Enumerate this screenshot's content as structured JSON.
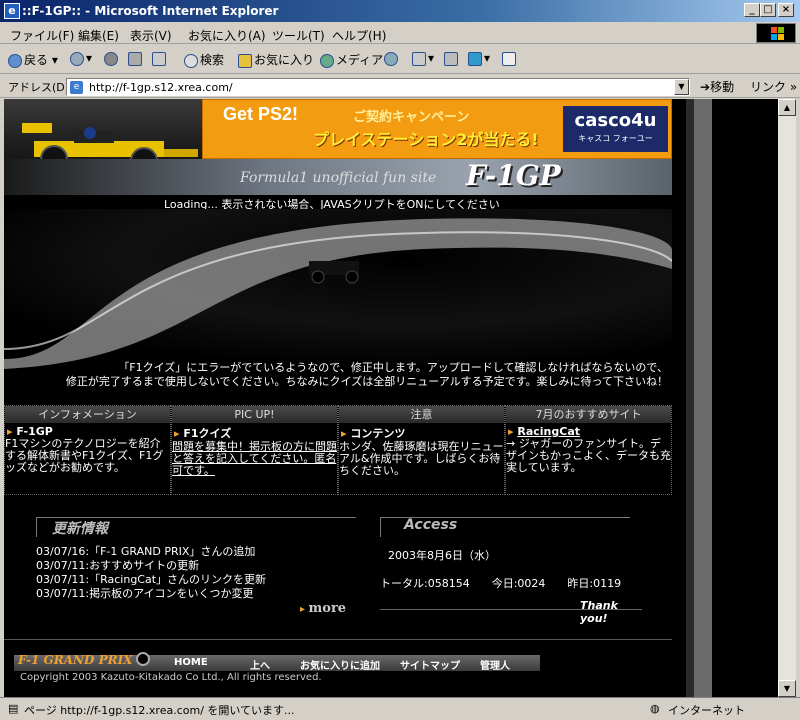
{
  "window": {
    "title": "::F-1GP:: - Microsoft Internet Explorer",
    "min_glyph": "_",
    "max_glyph": "□",
    "close_glyph": "×"
  },
  "menubar": {
    "items": [
      "ファイル(F)",
      "編集(E)",
      "表示(V)",
      "お気に入り(A)",
      "ツール(T)",
      "ヘルプ(H)"
    ]
  },
  "toolbar": {
    "back": "戻る",
    "search": "検索",
    "favorites": "お気に入り",
    "media": "メディア"
  },
  "address": {
    "label": "アドレス(D)",
    "url": "http://f-1gp.s12.xrea.com/",
    "go": "移動",
    "links": "リンク"
  },
  "page": {
    "banner": {
      "get_ps2": "Get PS2!",
      "campaign": "ご契約キャンペーン",
      "playstation": "プレイステーション2が当たる!",
      "casco": "casco4u",
      "casco_sub": "キャスコ フォーユー"
    },
    "tagline": "Formula1 unofficial fun site",
    "logo": "F-1GP",
    "loading": "Loading... 表示されない場合、JAVASクリプトをONにしてください",
    "notice_line1": "「F1クイズ」にエラーがでているようなので、修正中します。アップロードして確認しなければならないので、",
    "notice_line2": "修正が完了するまで使用しないでください。ちなみにクイズは全部リニューアルする予定です。楽しみに待って下さいね！",
    "columns": [
      {
        "head": "インフォメーション",
        "title": "F-1GP",
        "body": "F1マシンのテクノロジーを紹介する解体新書やF1クイズ、F1グッズなどがお勧めです。"
      },
      {
        "head": "PIC UP!",
        "title": "F1クイズ",
        "body": "問題を募集中！掲示板の方に問題と答えを記入してください。匿名可です。"
      },
      {
        "head": "注意",
        "title": "コンテンツ",
        "body": "ホンダ、佐藤琢磨は現在リニューアル&作成中です。しばらくお待ちください。"
      },
      {
        "head": "7月のおすすめサイト",
        "title": "RacingCat",
        "body": "→ ジャガーのファンサイト。デザインもかっこよく、データも充実しています。"
      }
    ],
    "updates": {
      "title": "更新情報",
      "lines": [
        "03/07/16:「F-1 GRAND PRIX」さんの追加",
        "03/07/11:おすすめサイトの更新",
        "03/07/11:「RacingCat」さんのリンクを更新",
        "03/07/11:掲示板のアイコンをいくつか変更"
      ],
      "more": "more"
    },
    "access": {
      "title": "Access",
      "date": "2003年8月6日（水）",
      "counts": "トータル:058154　　今日:0024　　昨日:0119",
      "thanks": "Thank you!"
    },
    "footer": {
      "logo": "F-1 GRAND PRIX",
      "nav": [
        "HOME",
        "上へ",
        "お気に入りに追加",
        "サイトマップ",
        "管理人"
      ],
      "copyright": "Copyright 2003 Kazuto-Kitakado Co Ltd., All rights reserved."
    }
  },
  "status": {
    "text": "ページ http://f-1gp.s12.xrea.com/ を開いています...",
    "zone": "インターネット"
  }
}
